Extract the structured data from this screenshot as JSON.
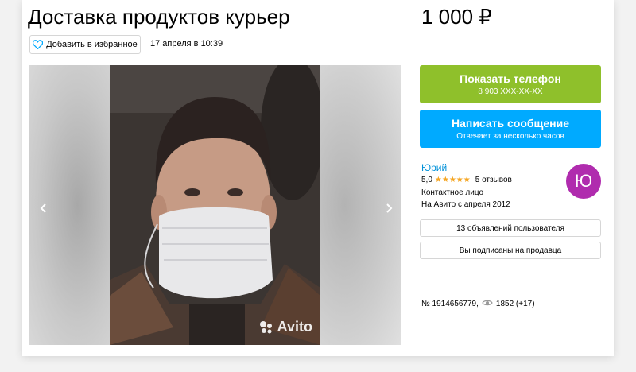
{
  "listing": {
    "title": "Доставка продуктов курьер",
    "price": "1 000 ₽",
    "favorite_label": "Добавить в избранное",
    "date": "17 апреля в 10:39"
  },
  "gallery": {
    "watermark": "Avito",
    "prev_icon": "chevron-left-icon",
    "next_icon": "chevron-right-icon"
  },
  "actions": {
    "phone_label": "Показать телефон",
    "phone_number": "8 903 XXX-XX-XX",
    "message_label": "Написать сообщение",
    "message_sub": "Отвечает за несколько часов"
  },
  "seller": {
    "name": "Юрий",
    "rating": "5,0",
    "stars": "★★★★★",
    "reviews": "5 отзывов",
    "role": "Контактное лицо",
    "since": "На Авито с апреля 2012",
    "avatar_letter": "Ю",
    "avatar_color": "#b02cae",
    "ads_label": "13 объявлений пользователя",
    "subscribed_label": "Вы подписаны на продавца"
  },
  "meta": {
    "number": "№ 1914656779,",
    "views": "1852 (+17)"
  },
  "colors": {
    "phone_button": "#8fc02b",
    "message_button": "#00aaff",
    "link": "#0091d9",
    "star": "#f5a623"
  }
}
